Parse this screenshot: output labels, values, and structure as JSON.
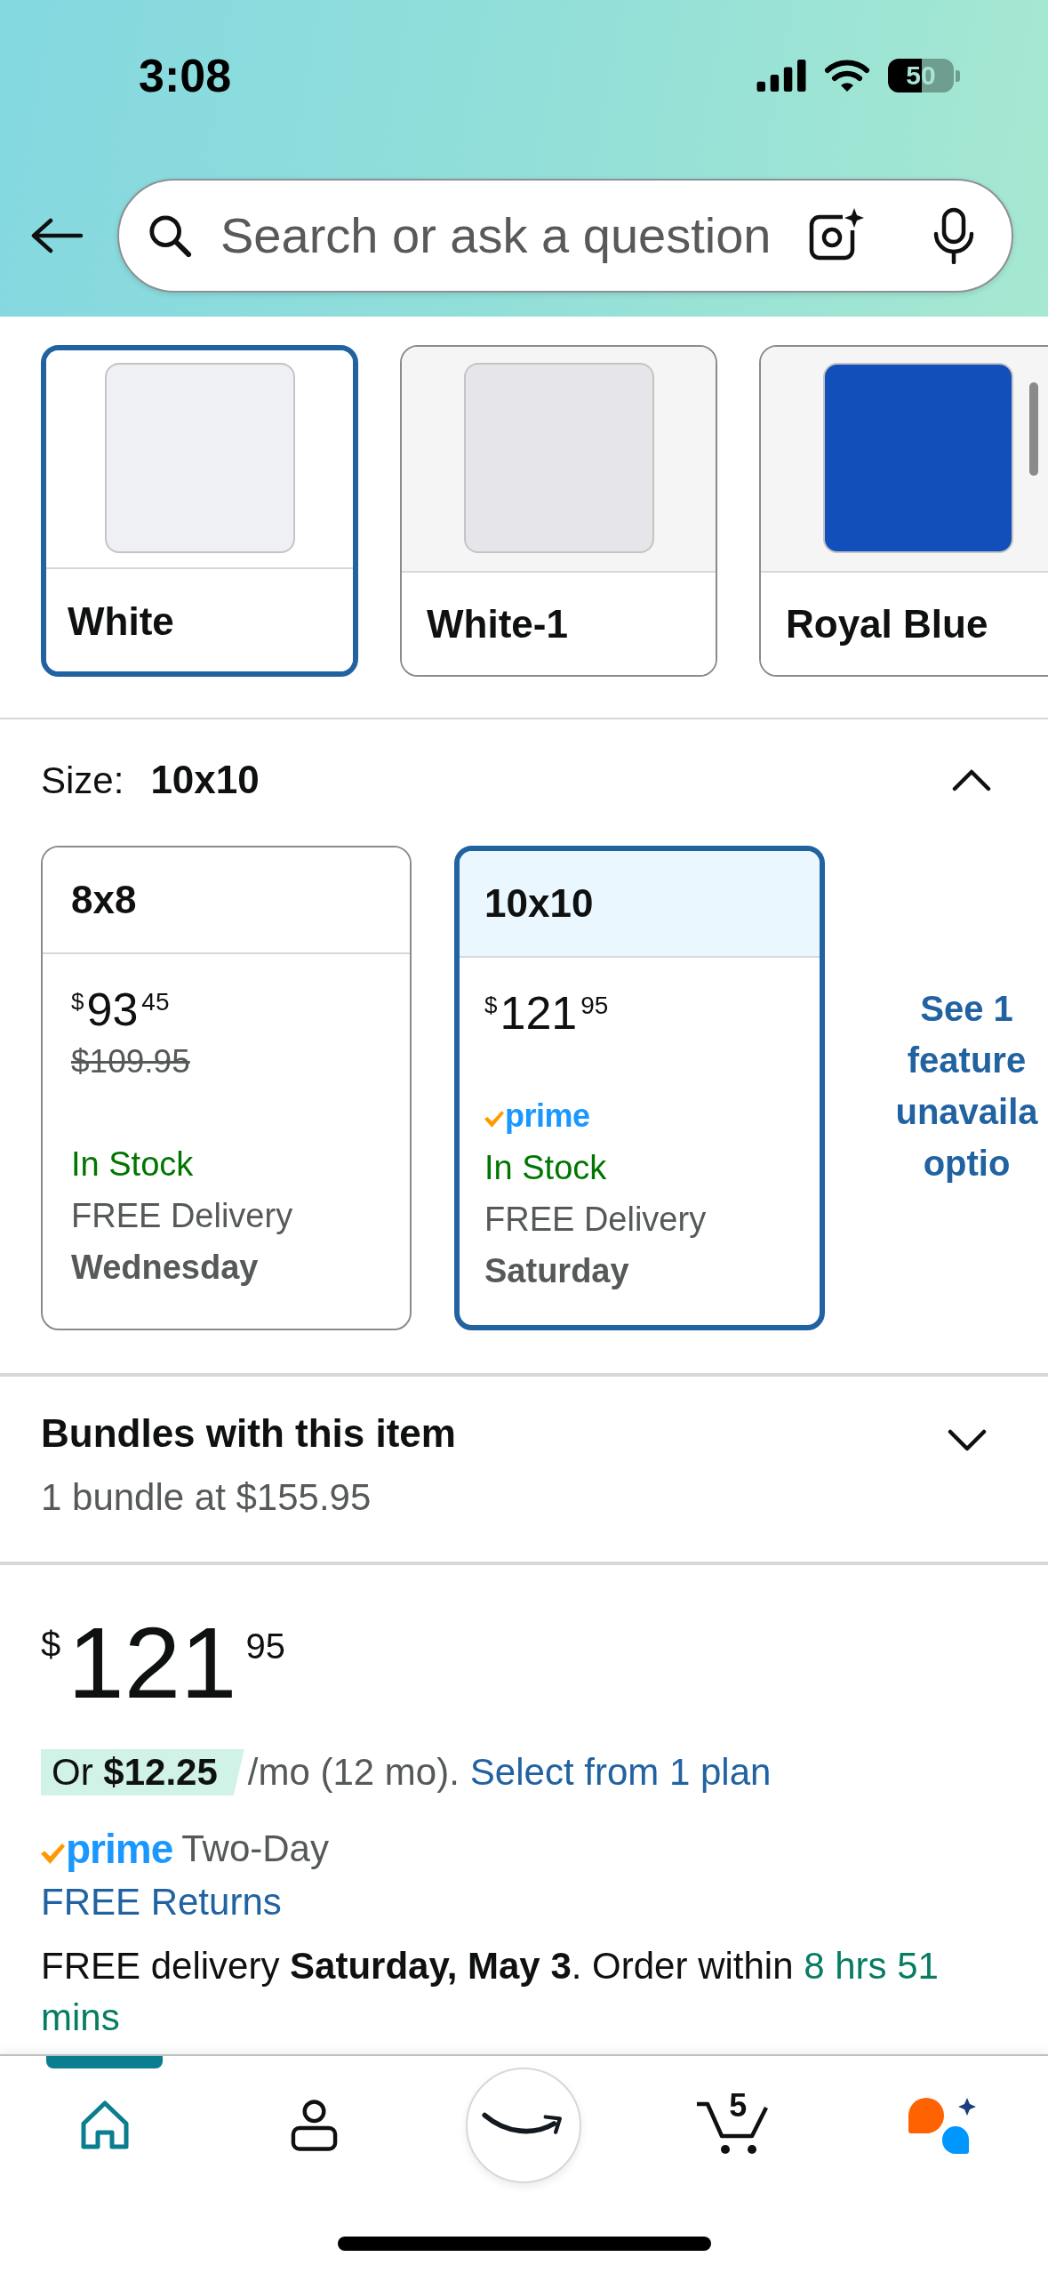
{
  "status_bar": {
    "time": "3:08",
    "battery": "50"
  },
  "search_bar": {
    "placeholder": "Search or ask a question"
  },
  "color_options": [
    {
      "label": "White",
      "color": "#eff0f4",
      "selected": true
    },
    {
      "label": "White-1",
      "color": "#e6e6ea",
      "selected": false
    },
    {
      "label": "Royal Blue",
      "color": "#124fba",
      "selected": false
    }
  ],
  "size_selector": {
    "label": "Size:",
    "value": "10x10",
    "expanded": true,
    "options": [
      {
        "label": "8x8",
        "price": {
          "currency": "$",
          "whole": "93",
          "fraction": "45"
        },
        "list_price": "$109.95",
        "availability": "In Stock",
        "delivery": "FREE Delivery",
        "delivery_day": "Wednesday",
        "selected": false
      },
      {
        "label": "10x10",
        "price": {
          "currency": "$",
          "whole": "121",
          "fraction": "95"
        },
        "prime_badge": "prime",
        "availability": "In Stock",
        "delivery": "FREE Delivery",
        "delivery_day": "Saturday",
        "selected": true
      }
    ],
    "more_options_link": [
      "See 1",
      "feature",
      "unavaila",
      "optio"
    ]
  },
  "bundles": {
    "title": "Bundles with this item",
    "summary": "1 bundle at $155.95",
    "expanded": false
  },
  "buy_box": {
    "price": {
      "currency": "$",
      "whole": "121",
      "fraction": "95"
    },
    "installment": {
      "badge": "Or **$12.25**",
      "terms": "/mo (12 mo).",
      "link": "Select from 1 plan"
    },
    "prime": {
      "badge": "prime",
      "text": "Two-Day"
    },
    "returns_link": "FREE Returns",
    "delivery": {
      "text": "FREE delivery **Saturday, May 3**. Order within",
      "countdown": "8 hrs 51 mins"
    }
  },
  "bottom_nav": [
    {
      "kind": "home",
      "selected": true
    },
    {
      "kind": "account",
      "selected": false
    },
    {
      "kind": "logo",
      "selected": false
    },
    {
      "kind": "cart",
      "count": "5",
      "selected": false
    },
    {
      "kind": "assistant",
      "selected": false
    }
  ]
}
